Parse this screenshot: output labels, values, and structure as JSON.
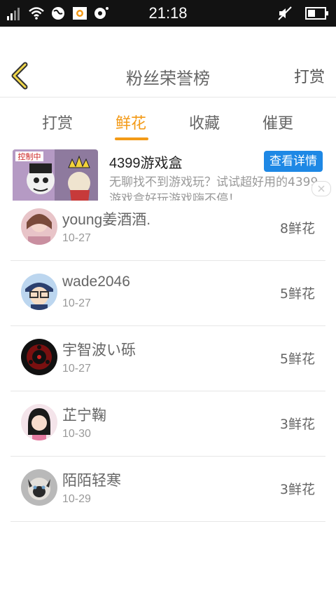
{
  "status_bar": {
    "time": "21:18",
    "left_icons": [
      "signal-icon",
      "wifi-icon",
      "globe-icon",
      "app-icon",
      "notification-icon"
    ],
    "right_icons": [
      "mute-icon",
      "battery-icon"
    ]
  },
  "header": {
    "back_icon": "back-arrow-icon",
    "title": "粉丝荣誉榜",
    "action_label": "打赏"
  },
  "tabs": [
    {
      "label": "打赏",
      "active": false
    },
    {
      "label": "鲜花",
      "active": true
    },
    {
      "label": "收藏",
      "active": false
    },
    {
      "label": "催更",
      "active": false
    }
  ],
  "ad": {
    "title": "4399游戏盒",
    "button_label": "查看详情",
    "description": "无聊找不到游戏玩？试试超好用的4399游戏盒好玩游戏嗨不停！",
    "thumb_text": "控制中"
  },
  "fans": [
    {
      "name": "young姜酒酒.",
      "date": "10-27",
      "flowers": "8鲜花"
    },
    {
      "name": "wade2046",
      "date": "10-27",
      "flowers": "5鲜花"
    },
    {
      "name": "宇智波い砾",
      "date": "10-27",
      "flowers": "5鲜花"
    },
    {
      "name": "芷宁鞠",
      "date": "10-30",
      "flowers": "3鲜花"
    },
    {
      "name": "陌陌轻寒",
      "date": "10-29",
      "flowers": "3鲜花"
    }
  ],
  "colors": {
    "accent": "#f39a17",
    "ad_button": "#1e88e5",
    "status_bar": "#121212"
  }
}
